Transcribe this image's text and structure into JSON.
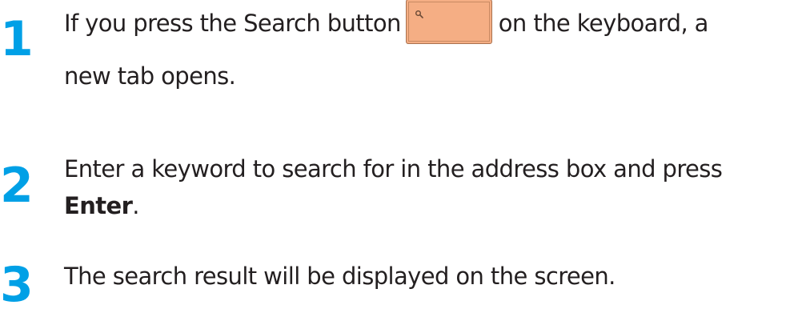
{
  "steps": [
    {
      "number": "1",
      "line1_before": "If you press the Search button",
      "key_icon": "search-icon",
      "line1_after": "on the keyboard, a",
      "line2": "new tab opens."
    },
    {
      "number": "2",
      "line1": "Enter a keyword to search for in the address box and press",
      "line2_bold": "Enter",
      "line2_rest": "."
    },
    {
      "number": "3",
      "line1": "The search result will be displayed on the screen."
    }
  ],
  "colors": {
    "step_number": "#00a0e6",
    "body_text": "#231f20",
    "key_fill": "#f5ae84"
  }
}
